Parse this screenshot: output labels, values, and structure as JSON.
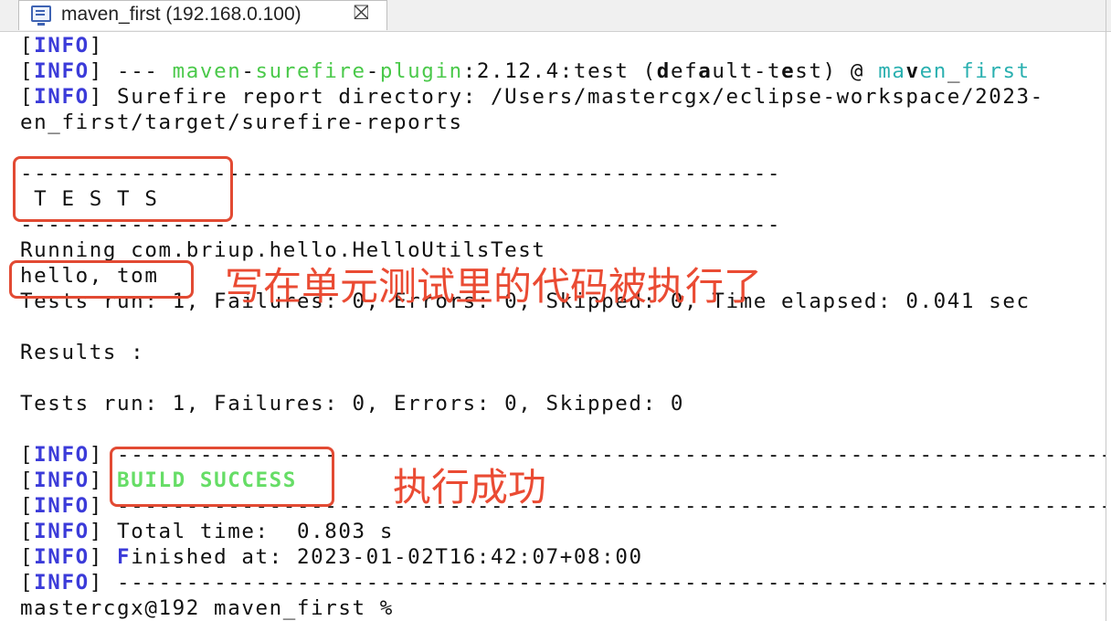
{
  "tab": {
    "title": "maven_first (192.168.0.100)",
    "icon": "terminal-icon",
    "close_glyph": "⛝"
  },
  "terminal": {
    "lines": [
      "[INFO]",
      "[INFO] --- maven-surefire-plugin:2.12.4:test (default-test) @ maven_first",
      "[INFO] Surefire report directory: /Users/mastercgx/eclipse-workspace/2023-",
      "en_first/target/surefire-reports",
      "",
      "-------------------------------------------------------",
      " T E S T S",
      "-------------------------------------------------------",
      "Running com.briup.hello.HelloUtilsTest",
      "hello, tom",
      "Tests run: 1, Failures: 0, Errors: 0, Skipped: 0, Time elapsed: 0.041 sec",
      "",
      "Results :",
      "",
      "Tests run: 1, Failures: 0, Errors: 0, Skipped: 0",
      "",
      "[INFO] ------------------------------------------------------------------------",
      "[INFO] BUILD SUCCESS",
      "[INFO] ------------------------------------------------------------------------",
      "[INFO] Total time:  0.803 s",
      "[INFO] Finished at: 2023-01-02T16:42:07+08:00",
      "[INFO] ------------------------------------------------------------------------",
      "mastercgx@192 maven_first %"
    ],
    "colors": {
      "info_tag": "#3b3bd9",
      "plugin": "#4ac94a",
      "build_success": "#66dd66",
      "project": "#2ab0b0"
    }
  },
  "annotations": {
    "test_note": "写在单元测试里的代码被执行了",
    "success_note": "执行成功",
    "color": "#ea4b33"
  }
}
